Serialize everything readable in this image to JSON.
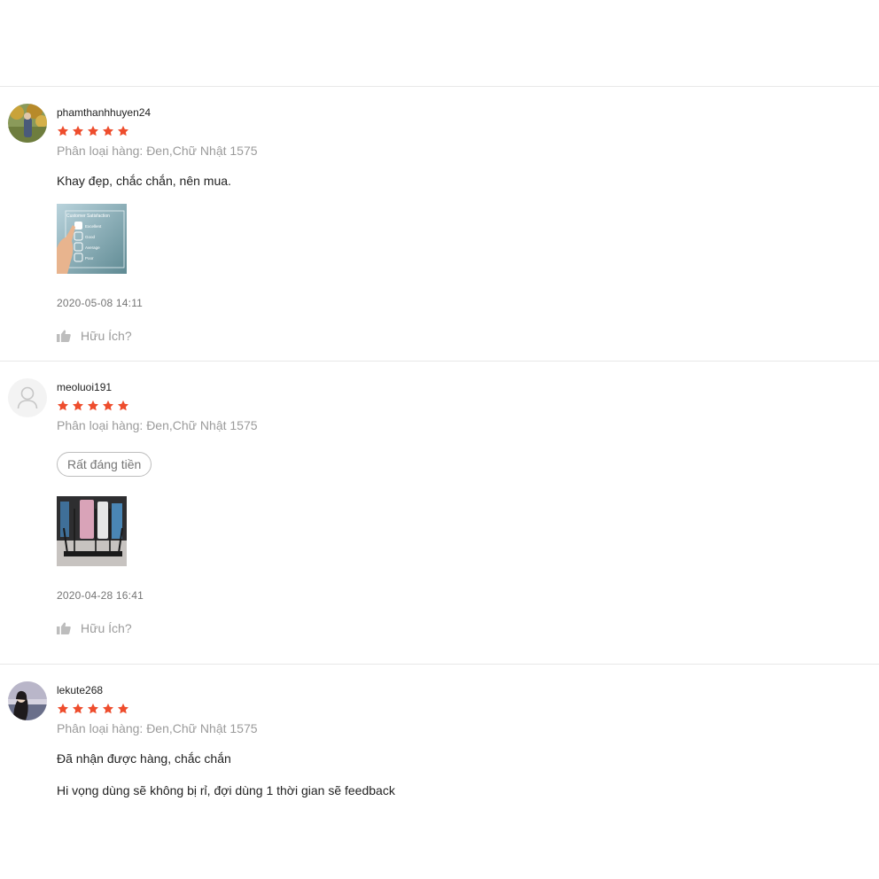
{
  "reviews": [
    {
      "username": "phamthanhhuyen24",
      "rating": 5,
      "variation": "Phân loại hàng: Đen,Chữ Nhật 1575",
      "comment": "Khay đẹp, chắc chắn, nên mua.",
      "image_text": {
        "title": "Customer Satisfaction",
        "options": [
          "Excellent",
          "Good",
          "Average",
          "Poor"
        ]
      },
      "time": "2020-05-08 14:11",
      "helpful_label": "Hữu Ích?"
    },
    {
      "username": "meoluoi191",
      "rating": 5,
      "variation": "Phân loại hàng: Đen,Chữ Nhật 1575",
      "tag": "Rất đáng tiền",
      "time": "2020-04-28 16:41",
      "helpful_label": "Hữu Ích?"
    },
    {
      "username": "lekute268",
      "rating": 5,
      "variation": "Phân loại hàng: Đen,Chữ Nhật 1575",
      "comment_lines": [
        "Đã nhận được hàng, chắc chắn",
        "Hi vọng dùng sẽ không bị rỉ, đợi dùng 1 thời gian sẽ feedback"
      ]
    }
  ],
  "colors": {
    "star": "#ee4d2d",
    "divider": "#e8e8e8",
    "muted": "#9b9b9b"
  },
  "icons": {
    "star": "star-icon",
    "like": "thumbs-up-icon",
    "default_avatar": "user-icon"
  }
}
